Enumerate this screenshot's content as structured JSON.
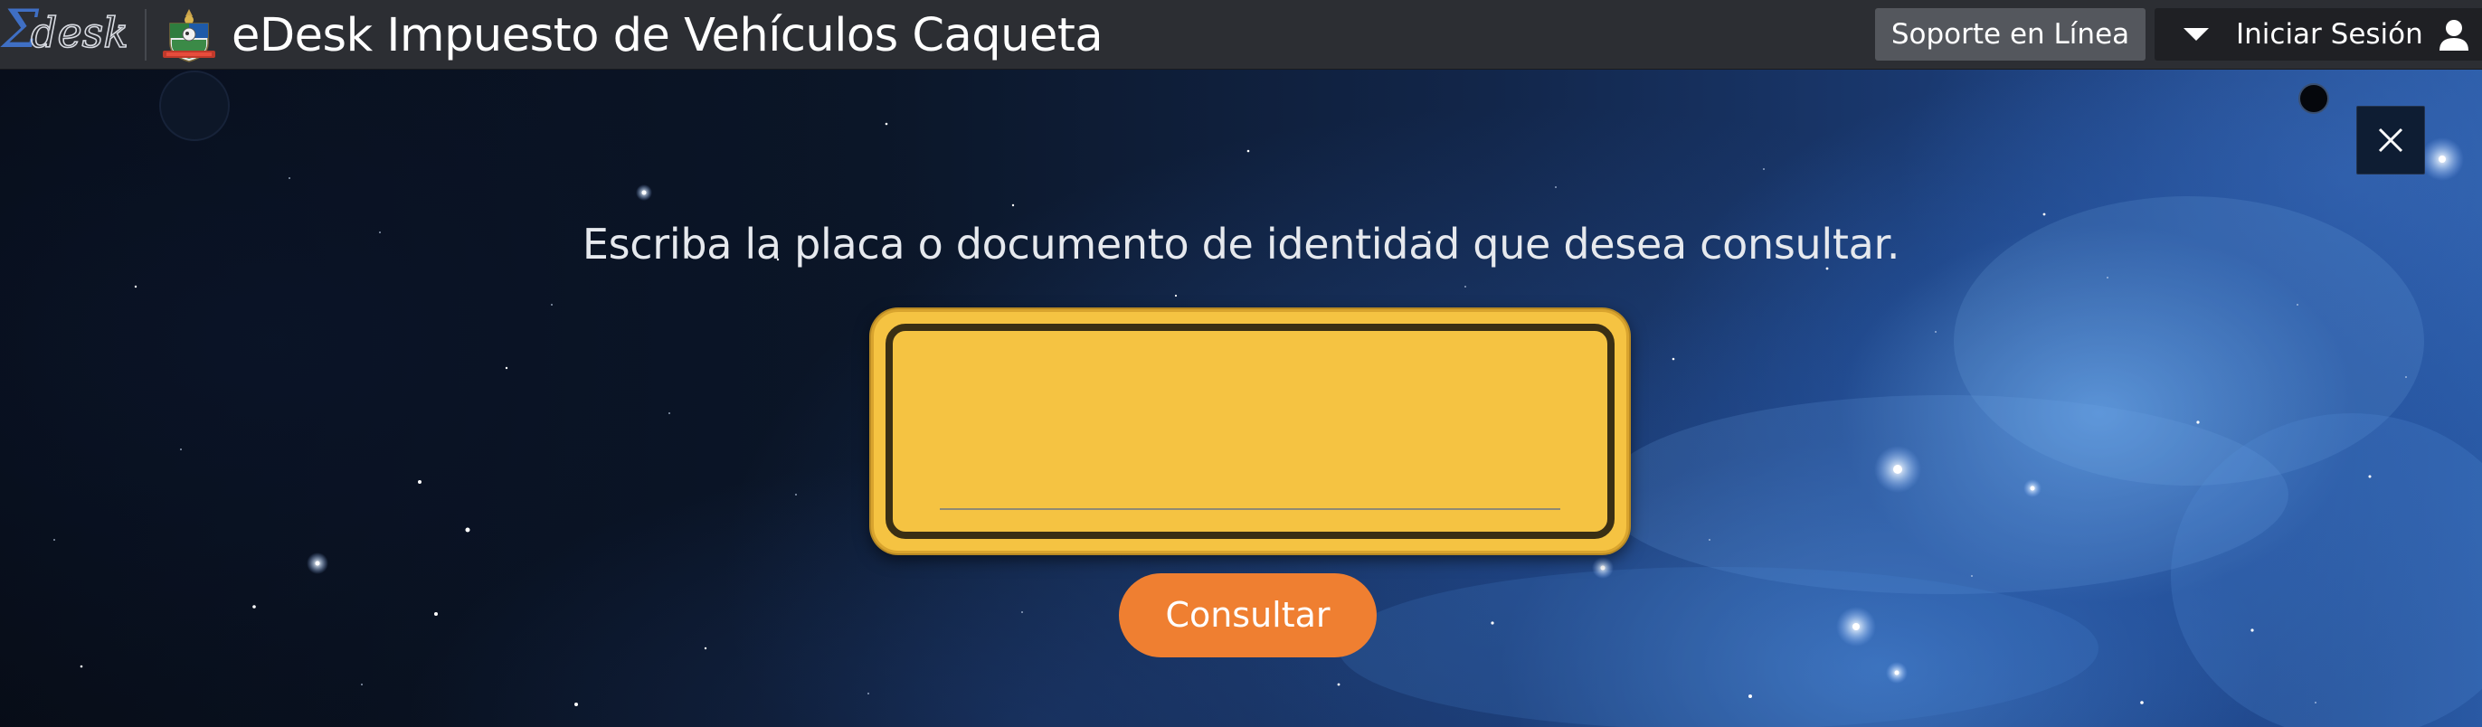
{
  "header": {
    "logo_icon": "edesk-sigma-logo",
    "crest_icon": "caqueta-crest",
    "title": "eDesk Impuesto de Vehículos Caqueta",
    "support_label": "Soporte en Línea",
    "login_label": "Iniciar Sesión",
    "login_caret_icon": "caret-down-icon",
    "login_user_icon": "user-icon"
  },
  "main": {
    "close_icon": "close-icon",
    "prompt": "Escriba la placa o documento de identidad que desea consultar.",
    "search_input": {
      "value": "",
      "placeholder": ""
    },
    "submit_label": "Consultar"
  },
  "colors": {
    "header_bg": "#2c2e33",
    "support_btn_bg": "#54575d",
    "login_btn_bg": "#1f2024",
    "plate_yellow": "#f5c342",
    "plate_border": "#3a2f14",
    "consult_orange": "#ef7f31"
  }
}
